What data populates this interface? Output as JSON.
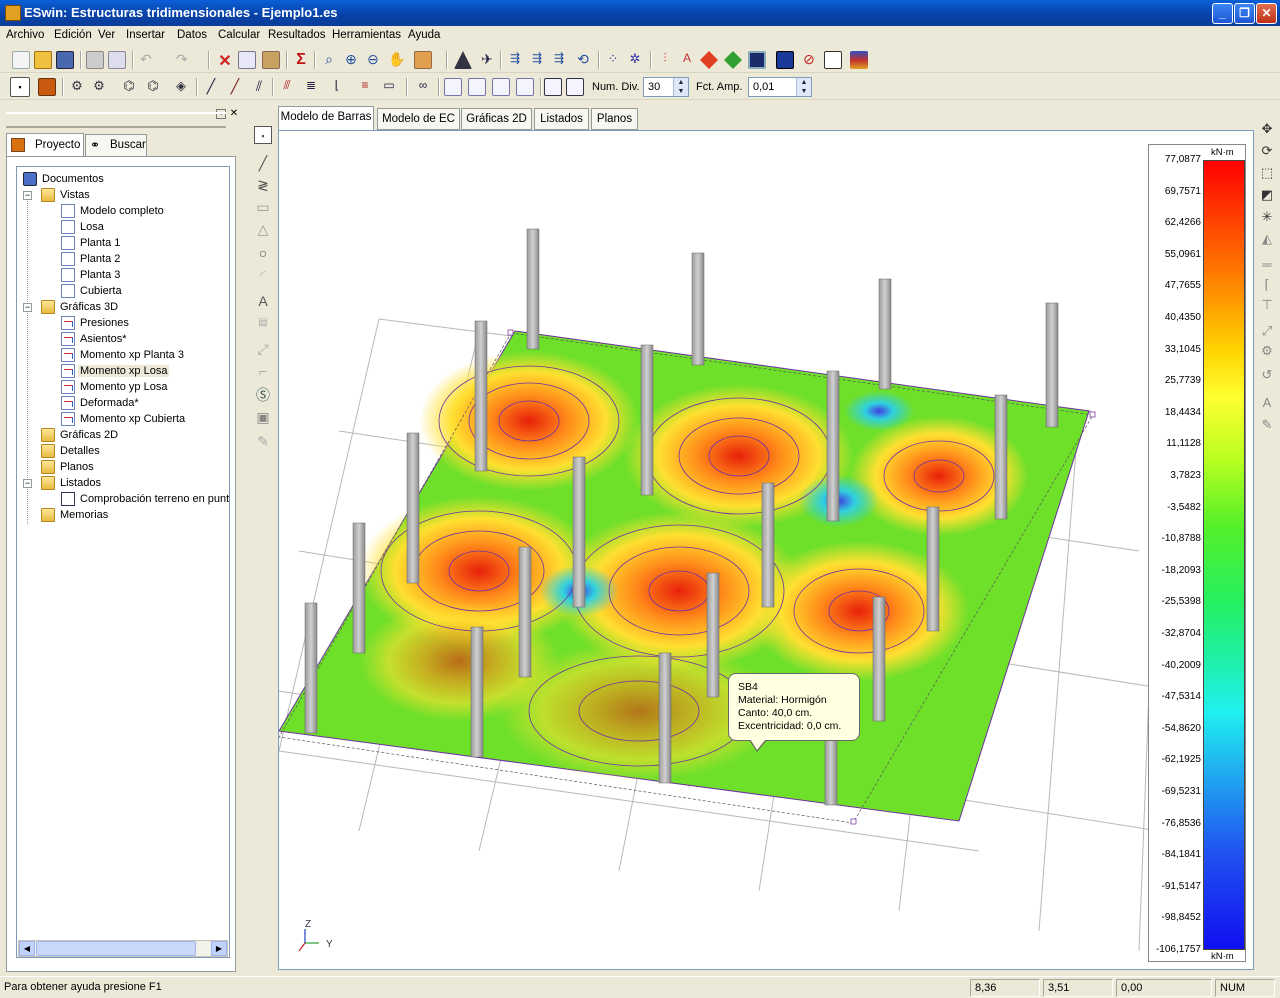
{
  "window": {
    "title": "ESwin: Estructuras tridimensionales - Ejemplo1.es"
  },
  "menu": [
    "Archivo",
    "Edición",
    "Ver",
    "Insertar",
    "Datos",
    "Calcular",
    "Resultados",
    "Herramientas",
    "Ayuda"
  ],
  "toolbar2": {
    "num_div_label": "Num. Div.",
    "num_div_value": "30",
    "fct_amp_label": "Fct. Amp.",
    "fct_amp_value": "0,01"
  },
  "panel": {
    "tabs": [
      "Proyecto",
      "Buscar"
    ],
    "tree": {
      "root": "Documentos",
      "vistas": "Vistas",
      "vistas_items": [
        "Modelo completo",
        "Losa",
        "Planta 1",
        "Planta 2",
        "Planta 3",
        "Cubierta"
      ],
      "graficas3d": "Gráficas 3D",
      "graficas3d_items": [
        "Presiones",
        "Asientos*",
        "Momento xp Planta 3",
        "Momento xp Losa",
        "Momento yp Losa",
        "Deformada*",
        "Momento xp Cubierta"
      ],
      "graficas2d": "Gráficas 2D",
      "detalles": "Detalles",
      "planos": "Planos",
      "listados": "Listados",
      "listados_items": [
        "Comprobación terreno en punto"
      ],
      "memorias": "Memorias"
    }
  },
  "main_tabs": [
    "Modelo de Barras",
    "Modelo de EC",
    "Gráficas 2D",
    "Listados",
    "Planos"
  ],
  "legend": {
    "unit": "kN·m",
    "values": [
      "77,0877",
      "69,7571",
      "62,4266",
      "55,0961",
      "47,7655",
      "40,4350",
      "33,1045",
      "25,7739",
      "18,4434",
      "11,1128",
      "3,7823",
      "-3,5482",
      "-10,8788",
      "-18,2093",
      "-25,5398",
      "-32,8704",
      "-40,2009",
      "-47,5314",
      "-54,8620",
      "-62,1925",
      "-69,5231",
      "-76,8536",
      "-84,1841",
      "-91,5147",
      "-98,8452",
      "-106,1757"
    ]
  },
  "tooltip": {
    "lines": [
      "SB4",
      "Material: Hormigón",
      "Canto: 40,0 cm.",
      "Excentricidad: 0,0 cm."
    ]
  },
  "axes": {
    "z": "Z",
    "y": "Y"
  },
  "status": {
    "help": "Para obtener ayuda presione F1",
    "x": "8,36",
    "y": "3,51",
    "z": "0,00",
    "mode": "NUM"
  }
}
